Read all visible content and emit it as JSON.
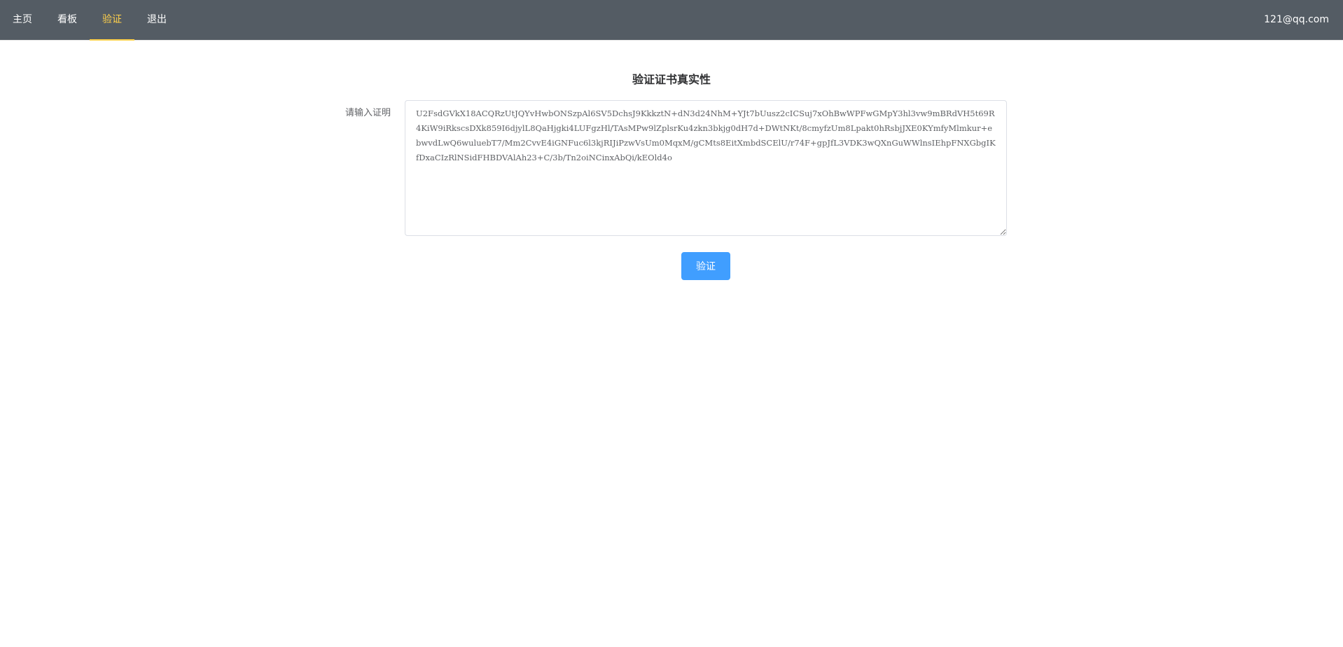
{
  "nav": {
    "items": [
      {
        "label": "主页"
      },
      {
        "label": "看板"
      },
      {
        "label": "验证"
      },
      {
        "label": "退出"
      }
    ],
    "active_index": 2
  },
  "user": {
    "email": "121@qq.com"
  },
  "main": {
    "title": "验证证书真实性",
    "form": {
      "label": "请输入证明",
      "certificate_value": "U2FsdGVkX18ACQRzUtJQYvHwbONSzpAl6SV5DchsJ9KkkztN+dN3d24NhM+YJt7bUusz2cICSuj7xOhBwWPFwGMpY3hl3vw9mBRdVH5t69R4KiW9iRkscsDXk859I6djylL8QaHjgki4LUFgzHl/TAsMPw9lZplsrKu4zkn3bkjg0dH7d+DWtNKt/8cmyfzUm8Lpakt0hRsbjJXE0KYmfyMlmkur+ebwvdLwQ6wuluebT7/Mm2CvvE4iGNFuc6l3kjRIJiPzwVsUm0MqxM/gCMts8EitXmbdSCElU/r74F+gpJfL3VDK3wQXnGuWWlnsIEhpFNXGbgIKfDxaCIzRlNSidFHBDVAlAh23+C/3b/Tn2oiNCinxAbQi/kEOld4o",
      "submit_label": "验证"
    }
  },
  "colors": {
    "header_bg": "#545c64",
    "active_nav": "#ffd04b",
    "primary": "#409eff"
  }
}
